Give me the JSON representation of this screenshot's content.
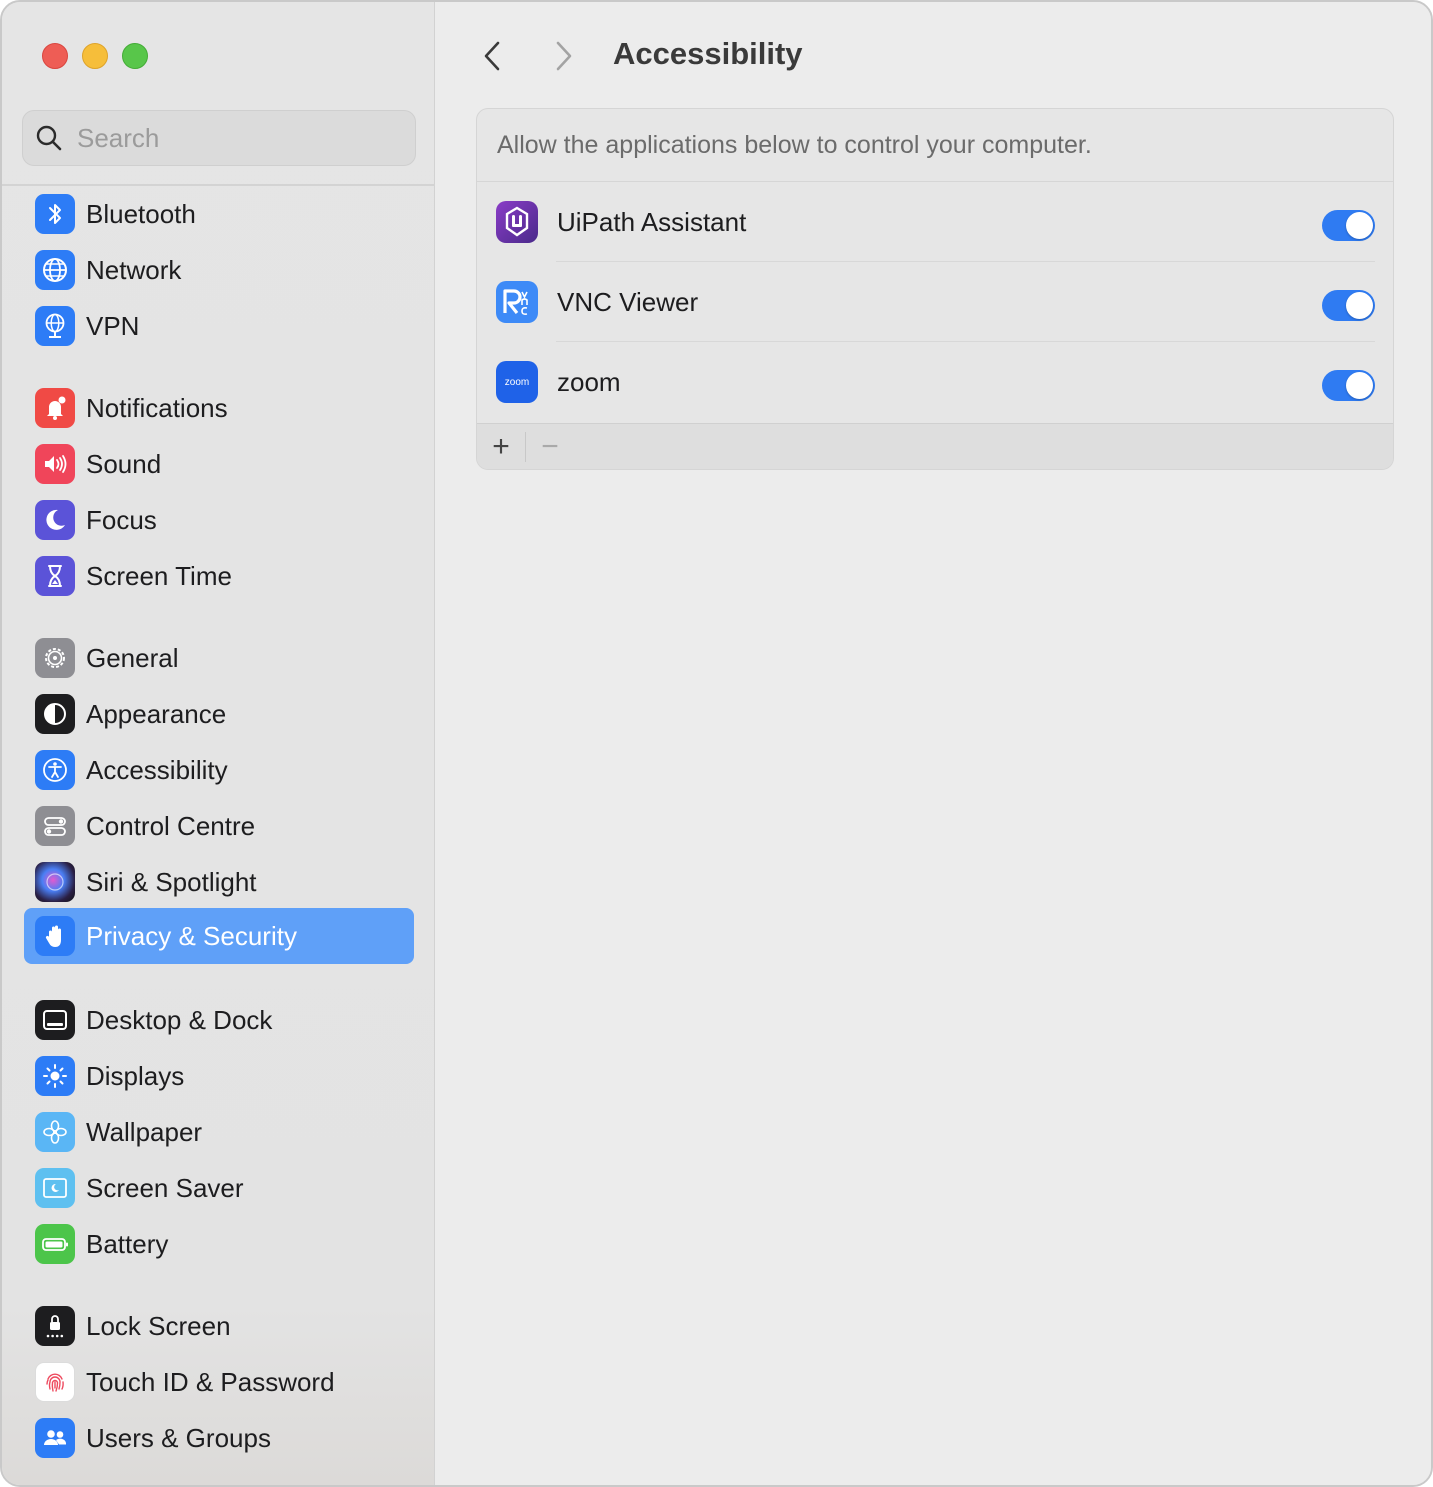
{
  "window": {
    "traffic_lights": [
      "close",
      "minimize",
      "zoom"
    ]
  },
  "search": {
    "placeholder": "Search",
    "value": ""
  },
  "sidebar": {
    "items": [
      {
        "label": "Bluetooth",
        "icon": "bluetooth-icon",
        "color": "#2d7cf6"
      },
      {
        "label": "Network",
        "icon": "globe-icon",
        "color": "#2d7cf6"
      },
      {
        "label": "VPN",
        "icon": "vpn-globe-icon",
        "color": "#2d7cf6"
      },
      {
        "label": "Notifications",
        "icon": "bell-icon",
        "color": "#f04a45"
      },
      {
        "label": "Sound",
        "icon": "speaker-icon",
        "color": "#f0455a"
      },
      {
        "label": "Focus",
        "icon": "moon-icon",
        "color": "#5b53d8"
      },
      {
        "label": "Screen Time",
        "icon": "hourglass-icon",
        "color": "#5b53d8"
      },
      {
        "label": "General",
        "icon": "gear-icon",
        "color": "#8e8e93"
      },
      {
        "label": "Appearance",
        "icon": "appearance-icon",
        "color": "#1d1d1f"
      },
      {
        "label": "Accessibility",
        "icon": "accessibility-icon",
        "color": "#2d7cf6"
      },
      {
        "label": "Control Centre",
        "icon": "toggles-icon",
        "color": "#8e8e93"
      },
      {
        "label": "Siri & Spotlight",
        "icon": "siri-icon",
        "color": "#3a2a5c"
      },
      {
        "label": "Privacy & Security",
        "icon": "hand-icon",
        "color": "#2d7cf6",
        "active": true
      },
      {
        "label": "Desktop & Dock",
        "icon": "dock-icon",
        "color": "#1d1d1f"
      },
      {
        "label": "Displays",
        "icon": "sun-icon",
        "color": "#2d7cf6"
      },
      {
        "label": "Wallpaper",
        "icon": "flower-icon",
        "color": "#5ab6f5"
      },
      {
        "label": "Screen Saver",
        "icon": "screensaver-icon",
        "color": "#5ec0f0"
      },
      {
        "label": "Battery",
        "icon": "battery-icon",
        "color": "#4cc54a"
      },
      {
        "label": "Lock Screen",
        "icon": "lock-icon",
        "color": "#1d1d1f"
      },
      {
        "label": "Touch ID & Password",
        "icon": "fingerprint-icon",
        "color": "#ffffff"
      },
      {
        "label": "Users & Groups",
        "icon": "users-icon",
        "color": "#2d7cf6"
      }
    ]
  },
  "header": {
    "title": "Accessibility"
  },
  "panel": {
    "description": "Allow the applications below to control your computer.",
    "apps": [
      {
        "name": "UiPath Assistant",
        "icon": "uipath-app-icon",
        "enabled": true
      },
      {
        "name": "VNC Viewer",
        "icon": "vnc-viewer-app-icon",
        "enabled": true
      },
      {
        "name": "zoom",
        "icon": "zoom-app-icon",
        "icon_text": "zoom",
        "enabled": true
      }
    ],
    "add_label": "+",
    "remove_label": "−"
  },
  "colors": {
    "accent": "#2f7bf2",
    "selection": "#5fa0f8"
  }
}
